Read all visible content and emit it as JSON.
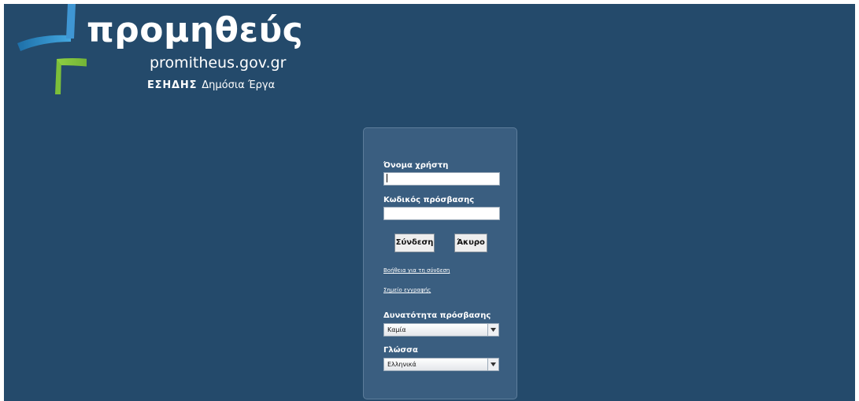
{
  "brand": {
    "name": "προμηθεύς",
    "domain": "promitheus.gov.gr",
    "sub_bold": "ΕΣΗΔΗΣ",
    "sub_text": "Δημόσια Έργα"
  },
  "login": {
    "username_label": "Όνομα χρήστη",
    "username_value": "",
    "password_label": "Κωδικός πρόσβασης",
    "password_value": "",
    "login_button": "Σύνδεση",
    "cancel_button": "Άκυρο",
    "help_link": "Βοήθεια για τη σύνδεση",
    "register_link": "Σημείο εγγραφής",
    "access_label": "Δυνατότητα πρόσβασης",
    "access_selected": "Καμία",
    "language_label": "Γλώσσα",
    "language_selected": "Ελληνικά"
  },
  "colors": {
    "background": "#244a6b",
    "panel": "#3a5e80",
    "logo_blue": "#2f8fd0",
    "logo_green": "#7cbf3a"
  }
}
